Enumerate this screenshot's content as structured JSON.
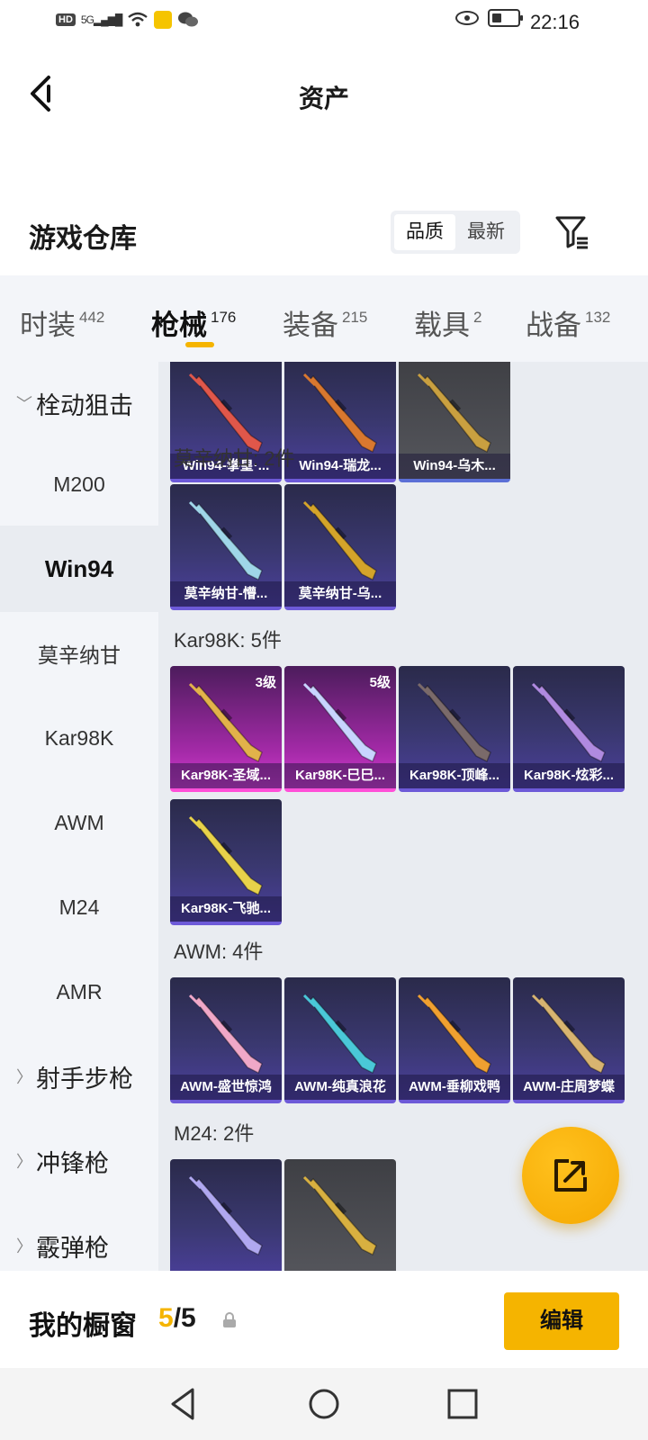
{
  "status_bar": {
    "time": "22:16",
    "hd": "HD",
    "signal": "5G"
  },
  "header": {
    "title": "资产"
  },
  "warehouse": {
    "title": "游戏仓库",
    "sort_options": [
      "品质",
      "最新"
    ],
    "sort_selected": "品质"
  },
  "tabs": [
    {
      "label": "时装",
      "count": "442"
    },
    {
      "label": "枪械",
      "count": "176"
    },
    {
      "label": "装备",
      "count": "215"
    },
    {
      "label": "载具",
      "count": "2"
    },
    {
      "label": "战备",
      "count": "132"
    }
  ],
  "active_tab": "枪械",
  "sidebar": {
    "items": [
      {
        "label": "栓动狙击",
        "type": "group",
        "expanded": true
      },
      {
        "label": "M200",
        "type": "item"
      },
      {
        "label": "Win94",
        "type": "item",
        "active": true
      },
      {
        "label": "莫辛纳甘",
        "type": "item"
      },
      {
        "label": "Kar98K",
        "type": "item"
      },
      {
        "label": "AWM",
        "type": "item"
      },
      {
        "label": "M24",
        "type": "item"
      },
      {
        "label": "AMR",
        "type": "item"
      },
      {
        "label": "射手步枪",
        "type": "group",
        "expanded": false
      },
      {
        "label": "冲锋枪",
        "type": "group",
        "expanded": false
      },
      {
        "label": "霰弹枪",
        "type": "group",
        "expanded": false
      }
    ]
  },
  "sections": [
    {
      "title": "",
      "items": [
        {
          "name": "Win94-拳皇·...",
          "style": "purple",
          "color": "#e0574a"
        },
        {
          "name": "Win94-瑞龙...",
          "style": "purple",
          "color": "#d9782f"
        },
        {
          "name": "Win94-乌木...",
          "style": "grey",
          "color": "#c9a040"
        }
      ]
    },
    {
      "title": "莫辛纳甘: 2件",
      "items": [
        {
          "name": "莫辛纳甘-懵...",
          "style": "purple",
          "color": "#9fd6e8"
        },
        {
          "name": "莫辛纳甘-乌...",
          "style": "purple",
          "color": "#d4a42a"
        }
      ]
    },
    {
      "title": "Kar98K: 5件",
      "items": [
        {
          "name": "Kar98K-圣域...",
          "style": "pink",
          "level": "3级",
          "color": "#e2b24a"
        },
        {
          "name": "Kar98K-巳巳...",
          "style": "pink",
          "level": "5级",
          "color": "#c8d4ff"
        },
        {
          "name": "Kar98K-顶峰...",
          "style": "purple",
          "color": "#7a6a6a"
        },
        {
          "name": "Kar98K-炫彩...",
          "style": "purple",
          "color": "#b08ae0"
        },
        {
          "name": "Kar98K-飞驰...",
          "style": "purple",
          "color": "#e8d24a"
        }
      ]
    },
    {
      "title": "AWM: 4件",
      "items": [
        {
          "name": "AWM-盛世惊鸿",
          "style": "purple",
          "color": "#f0a8c8"
        },
        {
          "name": "AWM-纯真浪花",
          "style": "purple",
          "color": "#4ac8d8"
        },
        {
          "name": "AWM-垂柳戏鸭",
          "style": "purple",
          "color": "#f0a030"
        },
        {
          "name": "AWM-庄周梦蝶",
          "style": "purple",
          "color": "#d8b470"
        }
      ]
    },
    {
      "title": "M24: 2件",
      "items": [
        {
          "name": "",
          "style": "purple",
          "color": "#b0a8f0"
        },
        {
          "name": "",
          "style": "grey",
          "color": "#d8b040"
        }
      ]
    }
  ],
  "bottom_bar": {
    "label": "我的橱窗",
    "current": "5",
    "separator": "/",
    "total": "5",
    "edit_label": "编辑"
  }
}
